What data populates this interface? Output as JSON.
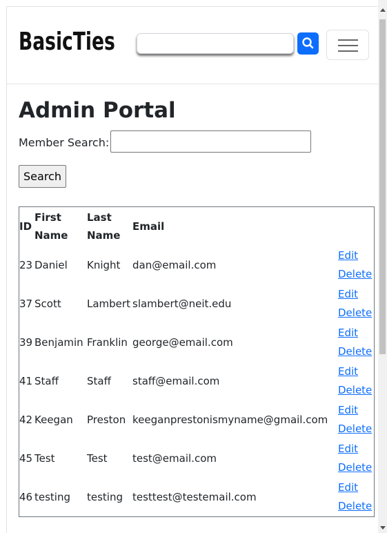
{
  "navbar": {
    "brand": "BasicTies",
    "search_value": "",
    "icons": {
      "search": "search-icon",
      "menu": "hamburger-menu-icon"
    },
    "accent_color": "#0d6efd"
  },
  "main": {
    "title": "Admin Portal",
    "member_search_label": "Member Search:",
    "member_search_value": "",
    "search_button": "Search"
  },
  "table": {
    "headers": {
      "id": "ID",
      "first_name": "First Name",
      "last_name": "Last Name",
      "email": "Email"
    },
    "rows": [
      {
        "id": "23",
        "first": "Daniel",
        "last": "Knight",
        "email": "dan@email.com",
        "edit": "Edit",
        "delete": "Delete"
      },
      {
        "id": "37",
        "first": "Scott",
        "last": "Lambert",
        "email": "slambert@neit.edu",
        "edit": "Edit",
        "delete": "Delete"
      },
      {
        "id": "39",
        "first": "Benjamin",
        "last": "Franklin",
        "email": "george@email.com",
        "edit": "Edit",
        "delete": "Delete"
      },
      {
        "id": "41",
        "first": "Staff",
        "last": "Staff",
        "email": "staff@email.com",
        "edit": "Edit",
        "delete": "Delete"
      },
      {
        "id": "42",
        "first": "Keegan",
        "last": "Preston",
        "email": "keeganprestonismyname@gmail.com",
        "edit": "Edit",
        "delete": "Delete"
      },
      {
        "id": "45",
        "first": "Test",
        "last": "Test",
        "email": "test@email.com",
        "edit": "Edit",
        "delete": "Delete"
      },
      {
        "id": "46",
        "first": "testing",
        "last": "testing",
        "email": "testtest@testemail.com",
        "edit": "Edit",
        "delete": "Delete"
      }
    ]
  }
}
